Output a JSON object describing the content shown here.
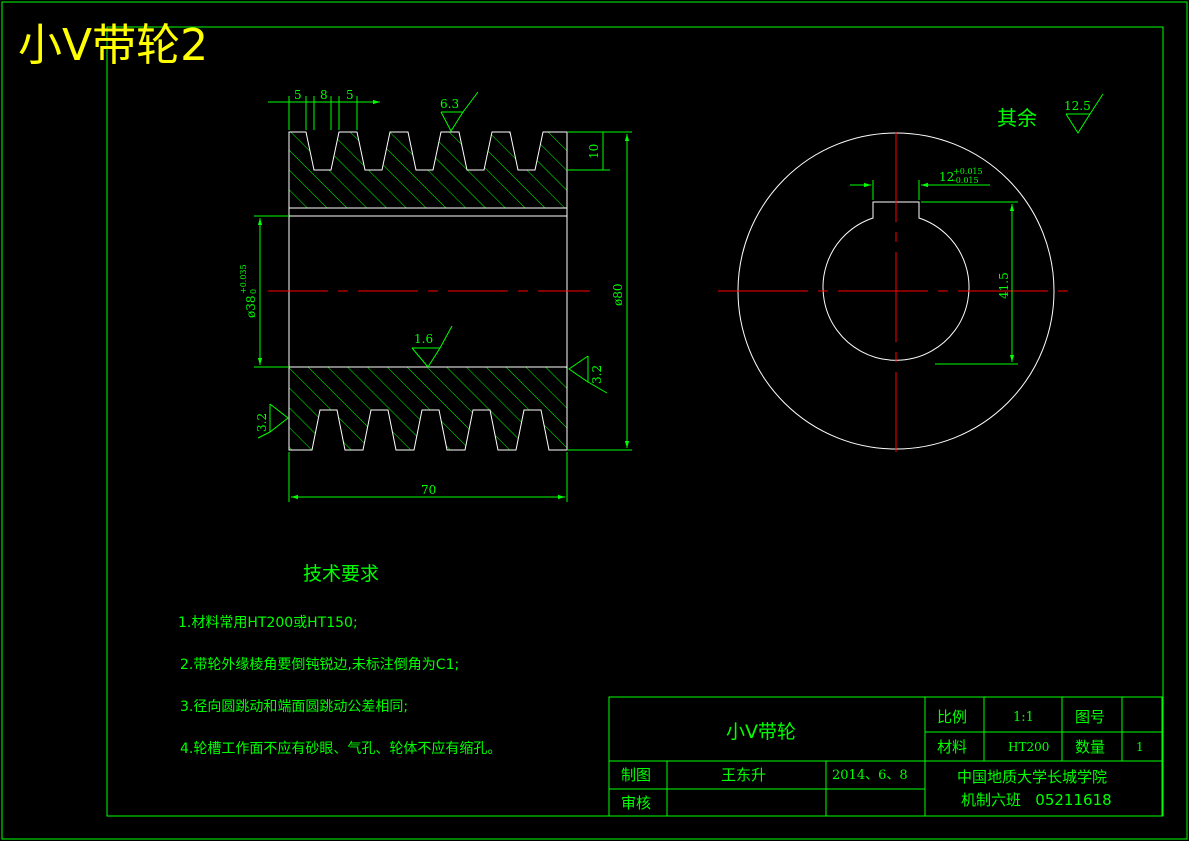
{
  "title": "小V带轮2",
  "colors": {
    "background": "#000000",
    "frame": "#00ff00",
    "outline": "#ffffff",
    "centerline": "#ff0000",
    "dimension": "#00ff00",
    "text": "#00ff00",
    "title_text": "#ffff00"
  },
  "section_view": {
    "dims": {
      "groove_w1": "5",
      "groove_pitch": "8",
      "groove_w2": "5",
      "groove_depth": "10",
      "length": "70",
      "outer_dia": "ø80",
      "bore_dia": "ø38",
      "bore_tol_upper": "+0.035",
      "bore_tol_lower": "0"
    },
    "roughness": {
      "groove_top": "6.3",
      "bore": "1.6",
      "right_face": "3.2",
      "left_face": "3.2"
    }
  },
  "end_view": {
    "remaining_label": "其余",
    "remaining_roughness": "12.5",
    "keyway_width": "12",
    "keyway_tol_upper": "+0.015",
    "keyway_tol_lower": "-0.015",
    "keyway_depth": "41.5"
  },
  "tech_requirements": {
    "heading": "技术要求",
    "items": [
      "1.材料常用HT200或HT150;",
      "2.带轮外缘棱角要倒钝锐边,未标注倒角为C1;",
      "3.径向圆跳动和端面圆跳动公差相同;",
      "4.轮槽工作面不应有砂眼、气孔、轮体不应有缩孔。"
    ]
  },
  "title_block": {
    "part_name": "小V带轮",
    "scale_label": "比例",
    "scale_value": "1:1",
    "drawing_no_label": "图号",
    "material_label": "材料",
    "material_value": "HT200",
    "quantity_label": "数量",
    "quantity_value": "1",
    "drawn_label": "制图",
    "drawn_by": "王东升",
    "date": "2014、6、8",
    "checked_label": "审核",
    "school": "中国地质大学长城学院",
    "class_id": "机制六班   05211618"
  }
}
